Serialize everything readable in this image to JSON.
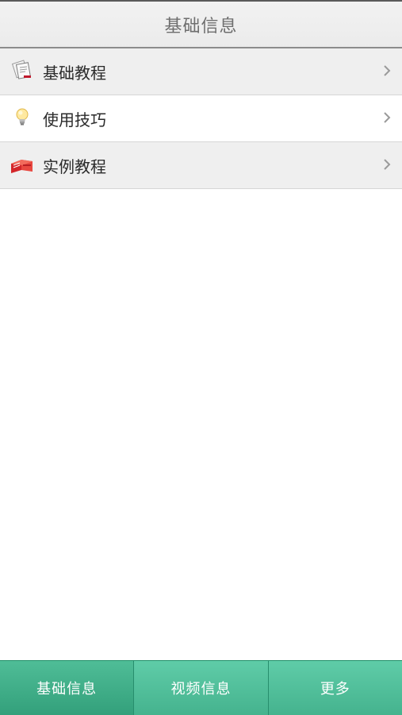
{
  "header": {
    "title": "基础信息"
  },
  "list": {
    "items": [
      {
        "label": "基础教程",
        "icon": "document-icon"
      },
      {
        "label": "使用技巧",
        "icon": "lightbulb-icon"
      },
      {
        "label": "实例教程",
        "icon": "books-icon"
      }
    ]
  },
  "tabbar": {
    "tabs": [
      {
        "label": "基础信息",
        "active": true
      },
      {
        "label": "视频信息",
        "active": false
      },
      {
        "label": "更多",
        "active": false
      }
    ]
  },
  "colors": {
    "tab_green": "#45b38e",
    "tab_active": "#33a07b",
    "list_alt_bg": "#efefef"
  }
}
